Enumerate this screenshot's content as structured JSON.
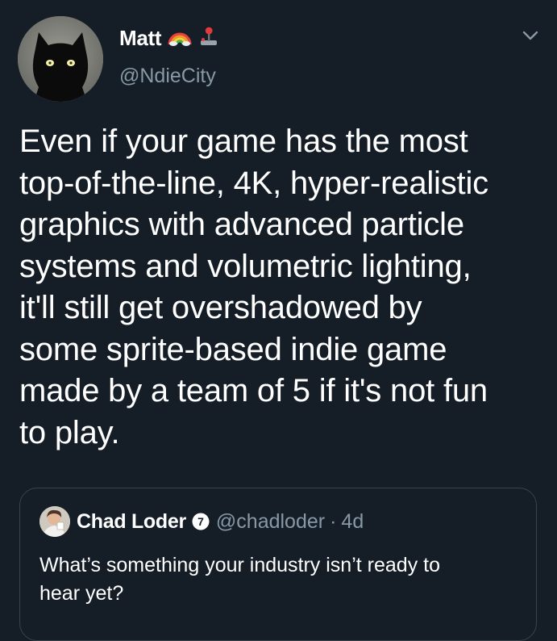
{
  "author": {
    "display_name": "Matt",
    "handle": "@NdieCity",
    "name_emojis": [
      "rainbow-icon",
      "joystick-icon"
    ],
    "avatar": "black-cat-avatar"
  },
  "tweet": {
    "text_lines": [
      "Even if your game has the most",
      "top-of-the-line, 4K, hyper-realistic",
      "graphics with advanced particle",
      "systems and volumetric lighting,",
      "it'll still get overshadowed by",
      "some sprite-based indie game",
      "made by a team of 5 if it's not fun",
      "to play."
    ],
    "menu_icon": "chevron-down-icon"
  },
  "quoted_tweet": {
    "display_name": "Chad Loder",
    "badge_text": "7",
    "handle": "@chadloder",
    "separator": "·",
    "time": "4d",
    "text_lines": [
      "What’s something your industry isn’t ready to",
      "hear yet?"
    ]
  },
  "colors": {
    "background": "#151d27",
    "primary_text": "#ffffff",
    "secondary_text": "#8899a6",
    "border": "#38444d"
  }
}
